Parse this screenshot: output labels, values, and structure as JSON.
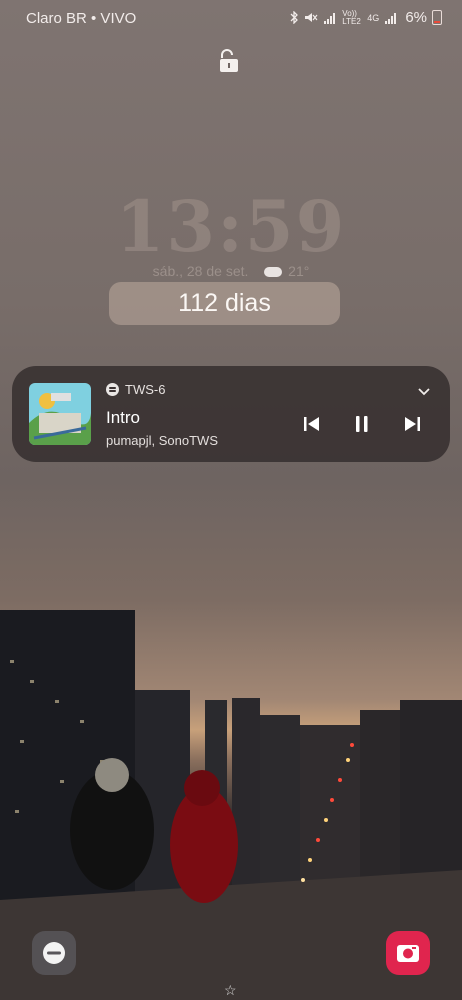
{
  "status_bar": {
    "carrier": "Claro BR • VIVO",
    "network_labels": [
      "Vo)) LTE2",
      "4G"
    ],
    "battery_text": "6%",
    "icons": [
      "bluetooth-icon",
      "mute-icon",
      "signal-icon",
      "signal-icon"
    ]
  },
  "lock_screen": {
    "time": "13:59",
    "date": "sáb., 28 de set.",
    "weather": "21°",
    "counter": "112 dias"
  },
  "media": {
    "app": "TWS-6",
    "track": "Intro",
    "artist": "pumapjl, SonoTWS",
    "icons": [
      "spotify-icon",
      "previous-icon",
      "pause-icon",
      "next-icon",
      "chevron-down-icon"
    ]
  },
  "shortcuts": {
    "left_icon": "do-not-disturb-icon",
    "right_icon": "camera-icon",
    "indicator": "☆"
  },
  "colors": {
    "camera_accent": "#e0254e",
    "battery_low": "#e84a3a"
  }
}
